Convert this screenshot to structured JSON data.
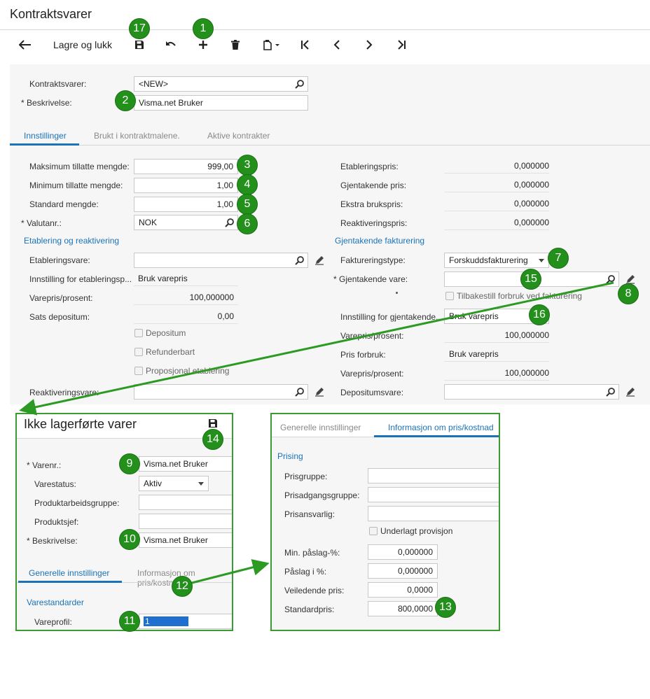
{
  "window": {
    "title": "Kontraktsvarer"
  },
  "toolbar": {
    "save_close_label": "Lagre og lukk"
  },
  "header": {
    "contract_item_label": "Kontraktsvarer:",
    "contract_item_value": "<NEW>",
    "description_label": "Beskrivelse:",
    "description_value": "Visma.net Bruker"
  },
  "tabs": [
    "Innstillinger",
    "Brukt i kontraktmalene.",
    "Aktive kontrakter"
  ],
  "settings": {
    "max_qty_label": "Maksimum tillatte mengde:",
    "max_qty_value": "999,00",
    "min_qty_label": "Minimum tillatte mengde:",
    "min_qty_value": "1,00",
    "std_qty_label": "Standard mengde:",
    "std_qty_value": "1,00",
    "currency_label": "Valutanr.:",
    "currency_value": "NOK",
    "setup_price_label": "Etableringspris:",
    "setup_price_value": "0,000000",
    "recurring_price_label": "Gjentakende pris:",
    "recurring_price_value": "0,000000",
    "extra_usage_label": "Ekstra brukspris:",
    "extra_usage_value": "0,000000",
    "reactivation_price_label": "Reaktiveringspris:",
    "reactivation_price_value": "0,000000"
  },
  "setup_section": {
    "heading": "Etablering og reaktivering",
    "setup_item_label": "Etableringsvare:",
    "setup_setting_label": "Innstilling for etableringsp...",
    "setup_setting_value": "Bruk varepris",
    "price_pct_label": "Varepris/prosent:",
    "price_pct_value": "100,000000",
    "deposit_rate_label": "Sats depositum:",
    "deposit_rate_value": "0,00",
    "chk_deposit": "Depositum",
    "chk_refundable": "Refunderbart",
    "chk_proportional": "Proposjonal etablering",
    "reactivation_item_label": "Reaktiveringsvare:"
  },
  "recurring_section": {
    "heading": "Gjentakende fakturering",
    "billing_type_label": "Faktureringstype:",
    "billing_type_value": "Forskuddsfakturering",
    "recurring_item_label": "Gjentakende vare:",
    "chk_reset_usage": "Tilbakestill forbruk ved fakturering",
    "recurring_setting_label": "Innstilling for gjentakende...",
    "recurring_setting_value": "Bruk varepris",
    "price_pct_label": "Varepris/prosent:",
    "price_pct_value": "100,000000",
    "usage_price_label": "Pris forbruk:",
    "usage_price_value": "Bruk varepris",
    "usage_price_pct_label": "Varepris/prosent:",
    "usage_price_pct_value": "100,000000",
    "deposit_item_label": "Depositumsvare:"
  },
  "panel_left": {
    "title": "Ikke lagerførte varer",
    "item_no_label": "Varenr.:",
    "item_no_value": "Visma.net Bruker",
    "status_label": "Varestatus:",
    "status_value": "Aktiv",
    "workgroup_label": "Produktarbeidsgruppe:",
    "manager_label": "Produktsjef:",
    "description_label": "Beskrivelse:",
    "description_value": "Visma.net Bruker",
    "tab_general": "Generelle innstillinger",
    "tab_pricing": "Informasjon om pris/kostn",
    "section_heading": "Varestandarder",
    "item_class_label": "Vareprofil:",
    "item_class_value": "1"
  },
  "panel_right": {
    "tab_general": "Generelle innstillinger",
    "tab_pricing": "Informasjon om pris/kostnad",
    "section_heading": "Prising",
    "price_group_label": "Prisgruppe:",
    "price_access_label": "Prisadgangsgruppe:",
    "price_manager_label": "Prisansvarlig:",
    "chk_commission": "Underlagt provisjon",
    "min_markup_label": "Min. påslag-%:",
    "min_markup_value": "0,000000",
    "markup_label": "Påslag i %:",
    "markup_value": "0,000000",
    "msrp_label": "Veiledende pris:",
    "msrp_value": "0,0000",
    "std_price_label": "Standardpris:",
    "std_price_value": "800,0000"
  },
  "badges": {
    "b1": "1",
    "b2": "2",
    "b3": "3",
    "b4": "4",
    "b5": "5",
    "b6": "6",
    "b7": "7",
    "b8": "8",
    "b9": "9",
    "b10": "10",
    "b11": "11",
    "b12": "12",
    "b13": "13",
    "b14": "14",
    "b15": "15",
    "b16": "16",
    "b17": "17"
  },
  "colors": {
    "accent": "#1a73b8",
    "badge": "#23901c",
    "panel_border": "#3c9a33",
    "arrow": "#2c9a23"
  }
}
